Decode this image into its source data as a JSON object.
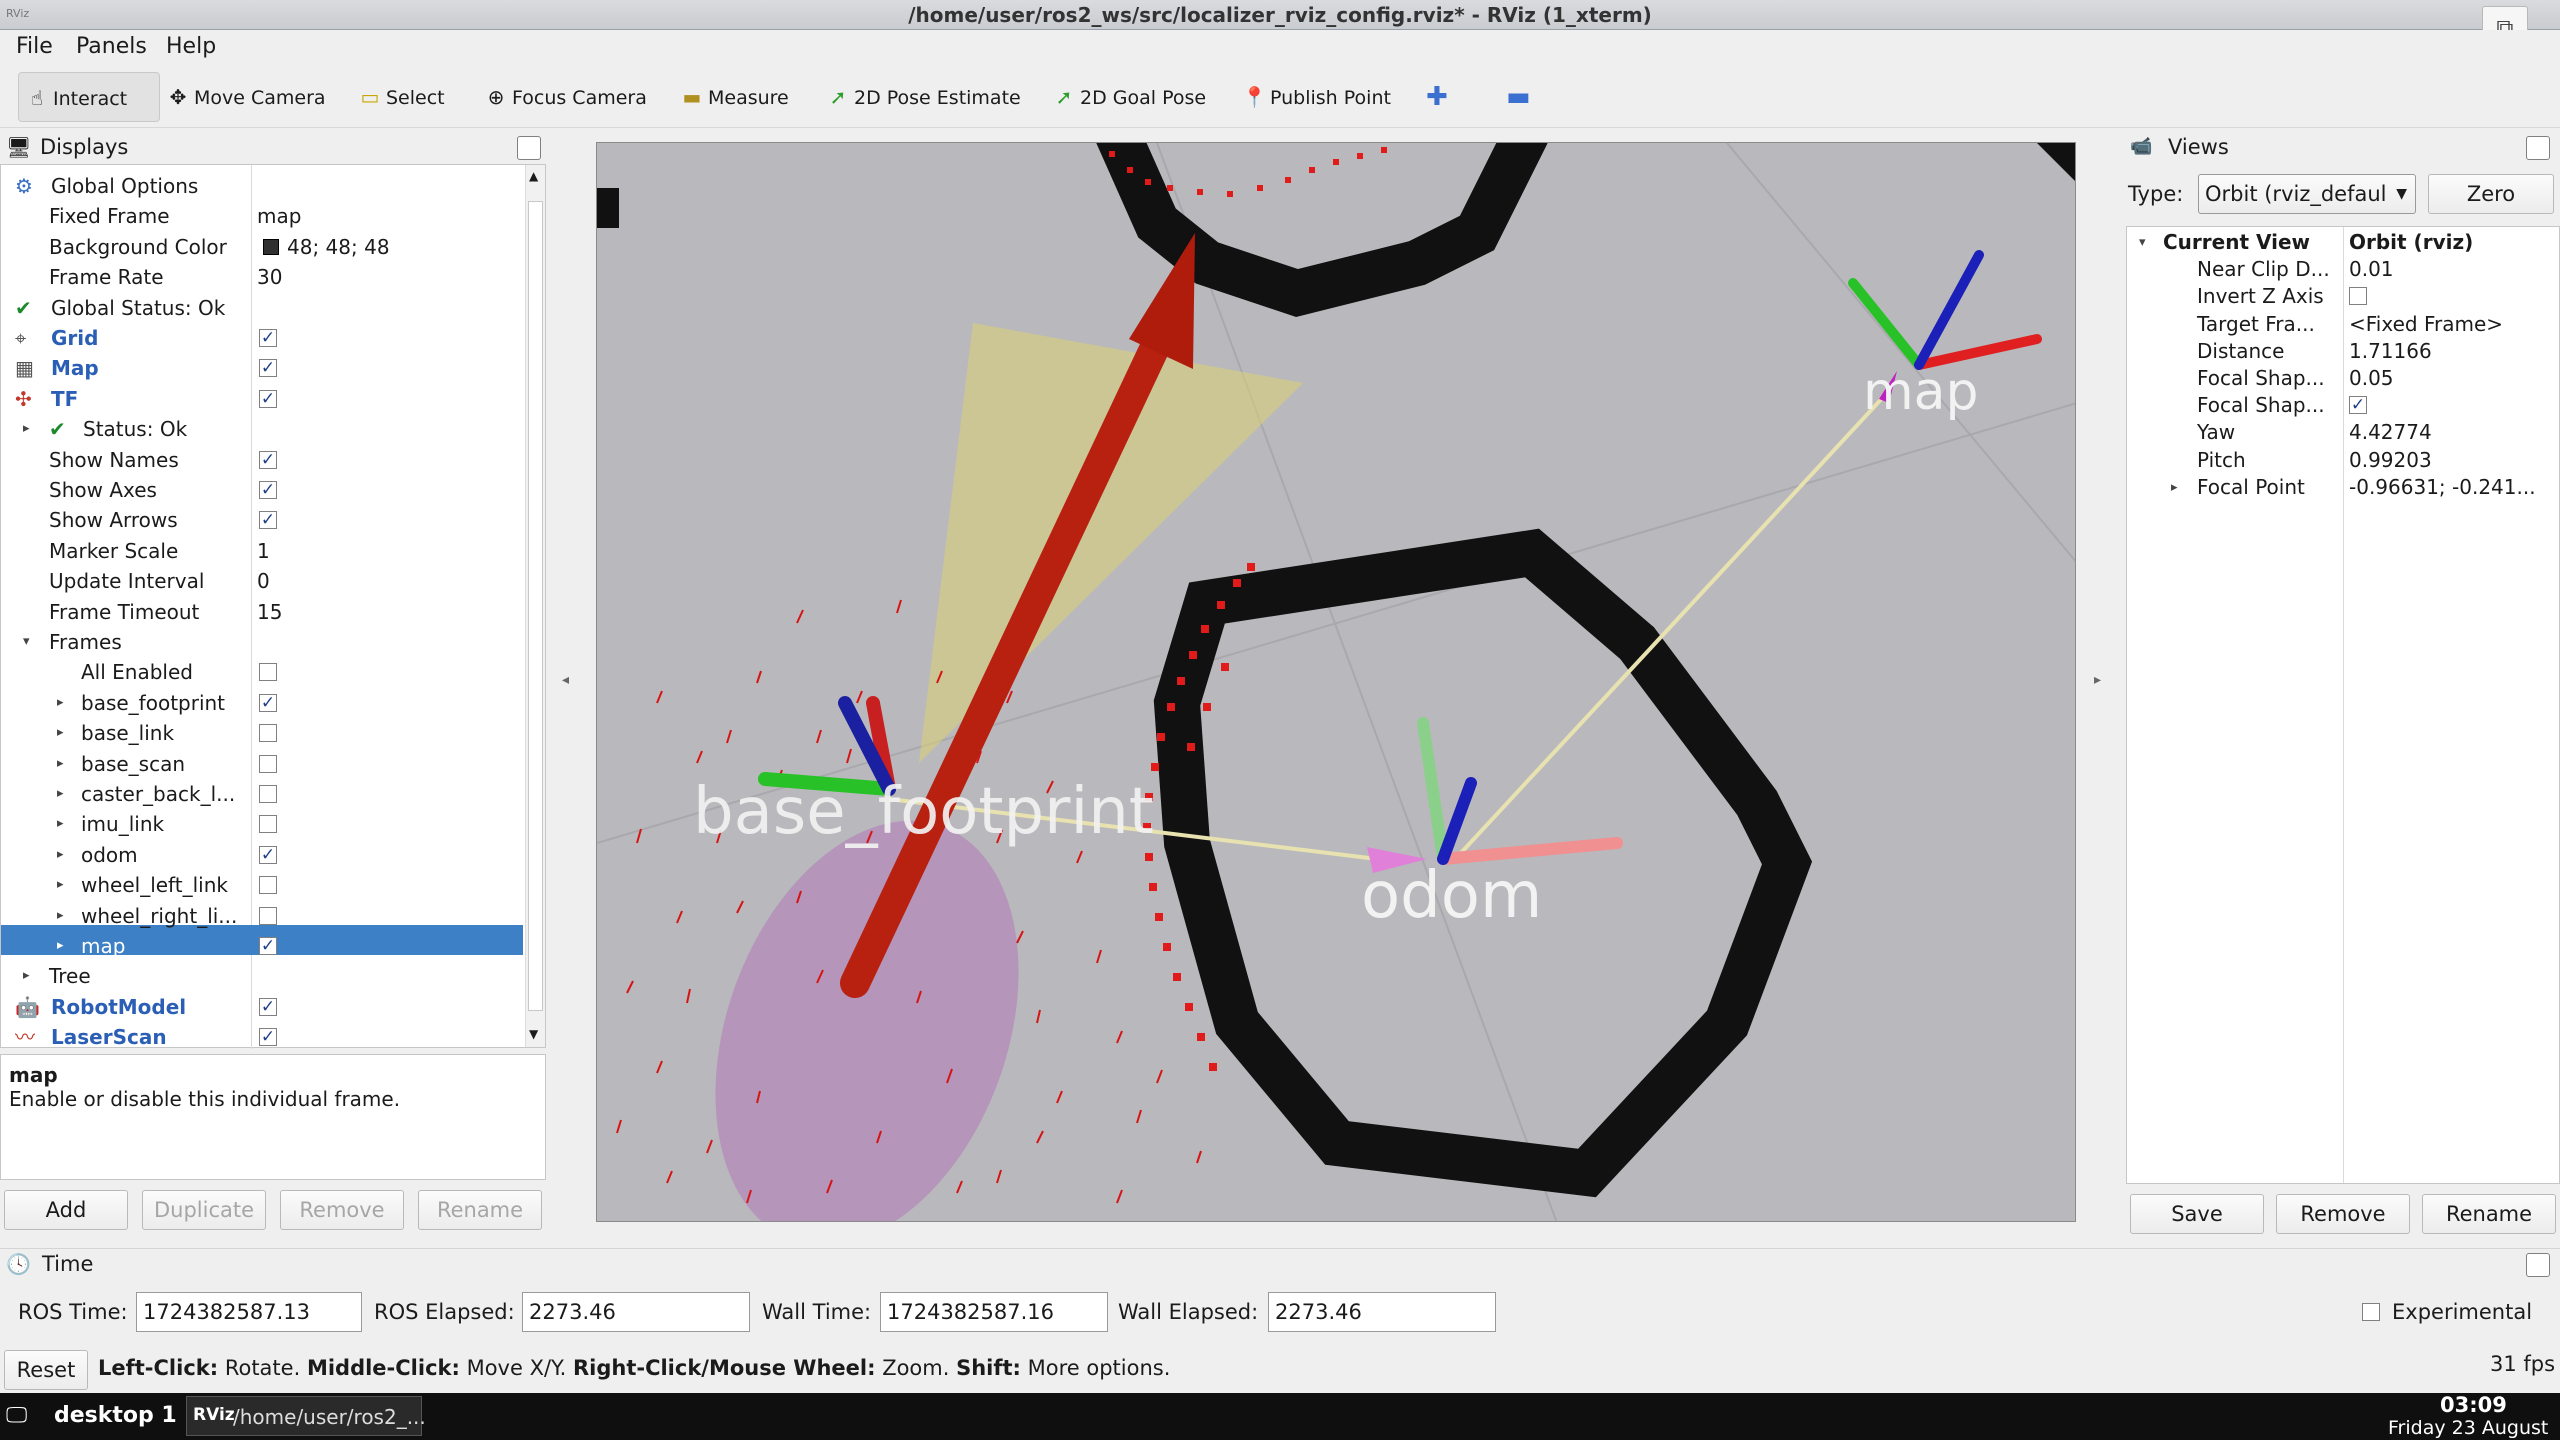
{
  "window": {
    "title": "/home/user/ros2_ws/src/localizer_rviz_config.rviz* - RViz (1_xterm)",
    "icon_label": "RViz",
    "restore_icon": "restore-icon"
  },
  "menu": [
    "File",
    "Panels",
    "Help"
  ],
  "toolbar": {
    "interact": "Interact",
    "move_camera": "Move Camera",
    "select": "Select",
    "focus_camera": "Focus Camera",
    "measure": "Measure",
    "pose_estimate": "2D Pose Estimate",
    "goal_pose": "2D Goal Pose",
    "publish_point": "Publish Point"
  },
  "displays": {
    "title": "Displays",
    "rows": [
      {
        "label": "Global Options",
        "value": ""
      },
      {
        "label": "Fixed Frame",
        "value": "map"
      },
      {
        "label": "Background Color",
        "value": "48; 48; 48",
        "swatch": "#303030"
      },
      {
        "label": "Frame Rate",
        "value": "30"
      },
      {
        "label": "Global Status: Ok",
        "value": ""
      },
      {
        "label": "Grid",
        "value": "",
        "checked": true
      },
      {
        "label": "Map",
        "value": "",
        "checked": true
      },
      {
        "label": "TF",
        "value": "",
        "checked": true
      },
      {
        "label": "Status: Ok",
        "value": ""
      },
      {
        "label": "Show Names",
        "value": "",
        "checked": true
      },
      {
        "label": "Show Axes",
        "value": "",
        "checked": true
      },
      {
        "label": "Show Arrows",
        "value": "",
        "checked": true
      },
      {
        "label": "Marker Scale",
        "value": "1"
      },
      {
        "label": "Update Interval",
        "value": "0"
      },
      {
        "label": "Frame Timeout",
        "value": "15"
      },
      {
        "label": "Frames",
        "value": ""
      },
      {
        "label": "All Enabled",
        "value": "",
        "checked": false
      },
      {
        "label": "base_footprint",
        "value": "",
        "checked": true
      },
      {
        "label": "base_link",
        "value": "",
        "checked": false
      },
      {
        "label": "base_scan",
        "value": "",
        "checked": false
      },
      {
        "label": "caster_back_l...",
        "value": "",
        "checked": false
      },
      {
        "label": "imu_link",
        "value": "",
        "checked": false
      },
      {
        "label": "odom",
        "value": "",
        "checked": true
      },
      {
        "label": "wheel_left_link",
        "value": "",
        "checked": false
      },
      {
        "label": "wheel_right_li...",
        "value": "",
        "checked": false
      },
      {
        "label": "map",
        "value": "",
        "checked": true
      },
      {
        "label": "Tree",
        "value": ""
      },
      {
        "label": "RobotModel",
        "value": "",
        "checked": true
      },
      {
        "label": "LaserScan",
        "value": "",
        "checked": true
      }
    ],
    "desc_title": "map",
    "desc_text": "Enable or disable this individual frame.",
    "buttons": [
      "Add",
      "Duplicate",
      "Remove",
      "Rename"
    ]
  },
  "viewport": {
    "labels": [
      "base_footprint",
      "odom",
      "map"
    ],
    "bg": "#b9b9bd"
  },
  "views": {
    "title": "Views",
    "type_label": "Type:",
    "type_value": "Orbit (rviz_defaul",
    "zero": "Zero",
    "rows": [
      {
        "label": "Current View",
        "value": "Orbit (rviz)"
      },
      {
        "label": "Near Clip D...",
        "value": "0.01"
      },
      {
        "label": "Invert Z Axis",
        "value": ""
      },
      {
        "label": "Target Fra...",
        "value": "<Fixed Frame>"
      },
      {
        "label": "Distance",
        "value": "1.71166"
      },
      {
        "label": "Focal Shap...",
        "value": "0.05"
      },
      {
        "label": "Focal Shap...",
        "value": ""
      },
      {
        "label": "Yaw",
        "value": "4.42774"
      },
      {
        "label": "Pitch",
        "value": "0.99203"
      },
      {
        "label": "Focal Point",
        "value": "-0.96631; -0.241..."
      }
    ],
    "buttons": [
      "Save",
      "Remove",
      "Rename"
    ]
  },
  "time": {
    "title": "Time",
    "ros_time_label": "ROS Time:",
    "ros_time": "1724382587.13",
    "ros_elapsed_label": "ROS Elapsed:",
    "ros_elapsed": "2273.46",
    "wall_time_label": "Wall Time:",
    "wall_time": "1724382587.16",
    "wall_elapsed_label": "Wall Elapsed:",
    "wall_elapsed": "2273.46",
    "experimental": "Experimental"
  },
  "status": {
    "reset": "Reset",
    "k1": "Left-Click:",
    "v1": "Rotate.",
    "k2": "Middle-Click:",
    "v2": "Move X/Y.",
    "k3": "Right-Click/Mouse Wheel:",
    "v3": "Zoom.",
    "k4": "Shift:",
    "v4": "More options.",
    "fps": "31 fps"
  },
  "taskbar": {
    "desktop": "desktop 1",
    "task_icon": "RViz",
    "task": "/home/user/ros2_...",
    "time": "03:09",
    "date": "Friday 23 August"
  }
}
